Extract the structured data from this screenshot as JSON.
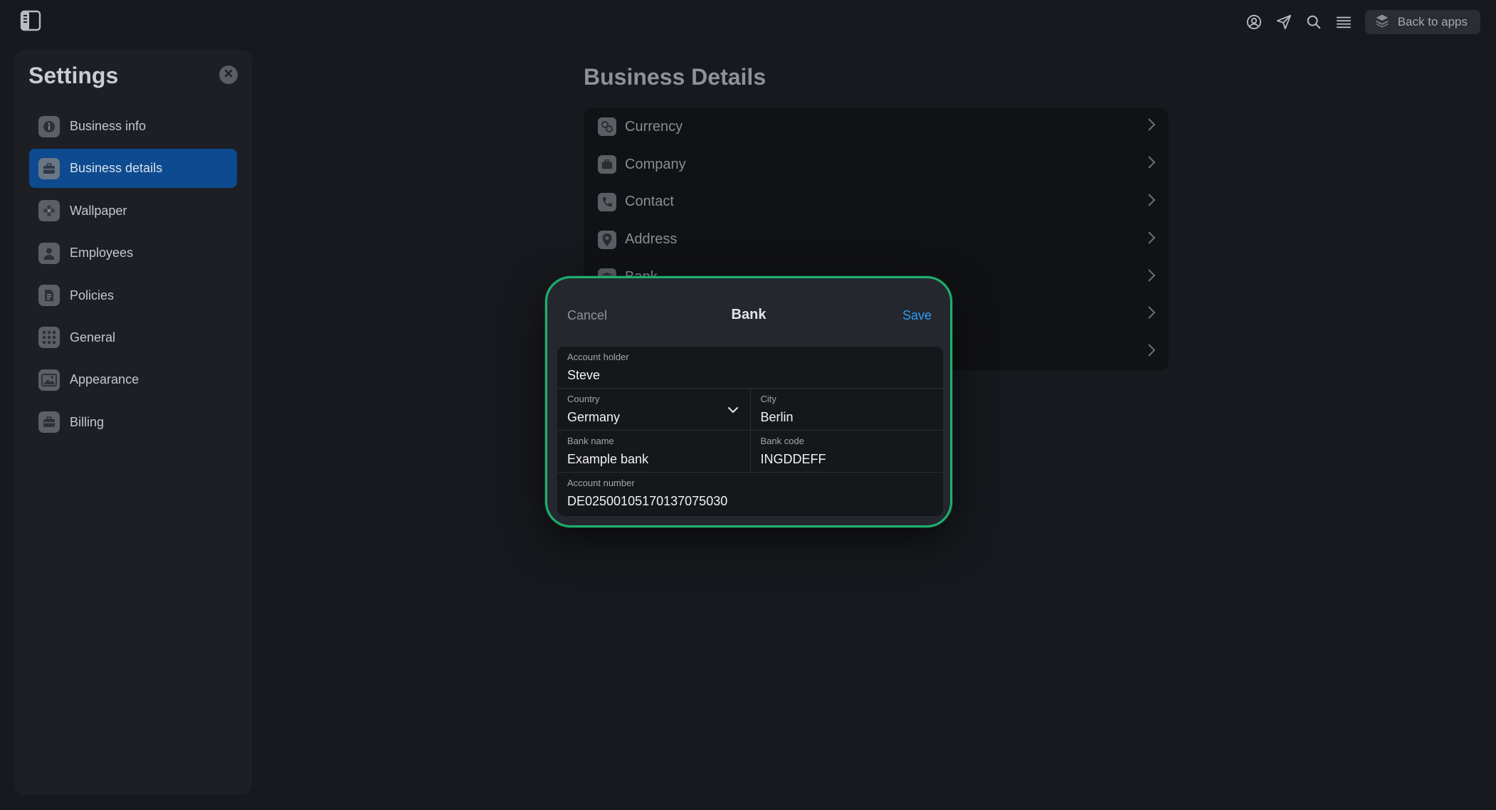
{
  "topbar": {
    "sidebar_toggle_icon": "sidebar-toggle-icon",
    "icons": [
      "user-circle-icon",
      "send-icon",
      "search-icon",
      "menu-icon"
    ],
    "back_button_label": "Back to apps",
    "back_button_icon": "stack-icon"
  },
  "settings": {
    "title": "Settings",
    "items": [
      {
        "label": "Business info",
        "icon": "info-icon"
      },
      {
        "label": "Business details",
        "icon": "briefcase-icon",
        "active": true
      },
      {
        "label": "Wallpaper",
        "icon": "flower-icon"
      },
      {
        "label": "Employees",
        "icon": "person-icon"
      },
      {
        "label": "Policies",
        "icon": "document-icon"
      },
      {
        "label": "General",
        "icon": "grid-icon"
      },
      {
        "label": "Appearance",
        "icon": "image-icon"
      },
      {
        "label": "Billing",
        "icon": "briefcase-icon"
      }
    ]
  },
  "business_details": {
    "title": "Business Details",
    "rows": [
      {
        "label": "Currency",
        "icon": "currency-icon"
      },
      {
        "label": "Company",
        "icon": "briefcase-icon"
      },
      {
        "label": "Contact",
        "icon": "phone-icon"
      },
      {
        "label": "Address",
        "icon": "location-pin-icon"
      },
      {
        "label": "Bank",
        "icon": "bank-icon"
      },
      {
        "label": "",
        "icon": ""
      },
      {
        "label": "",
        "icon": ""
      }
    ]
  },
  "modal": {
    "title": "Bank",
    "cancel_label": "Cancel",
    "save_label": "Save",
    "fields": {
      "account_holder": {
        "label": "Account holder",
        "value": "Steve"
      },
      "country": {
        "label": "Country",
        "value": "Germany"
      },
      "city": {
        "label": "City",
        "value": "Berlin"
      },
      "bank_name": {
        "label": "Bank name",
        "value": "Example bank"
      },
      "bank_code": {
        "label": "Bank code",
        "value": "INGDDEFF"
      },
      "account_number": {
        "label": "Account number",
        "value": "DE02500105170137075030"
      }
    }
  },
  "colors": {
    "accent_active": "#0d4a8f",
    "modal_border": "#1fae70",
    "save_link": "#2a9df4"
  }
}
